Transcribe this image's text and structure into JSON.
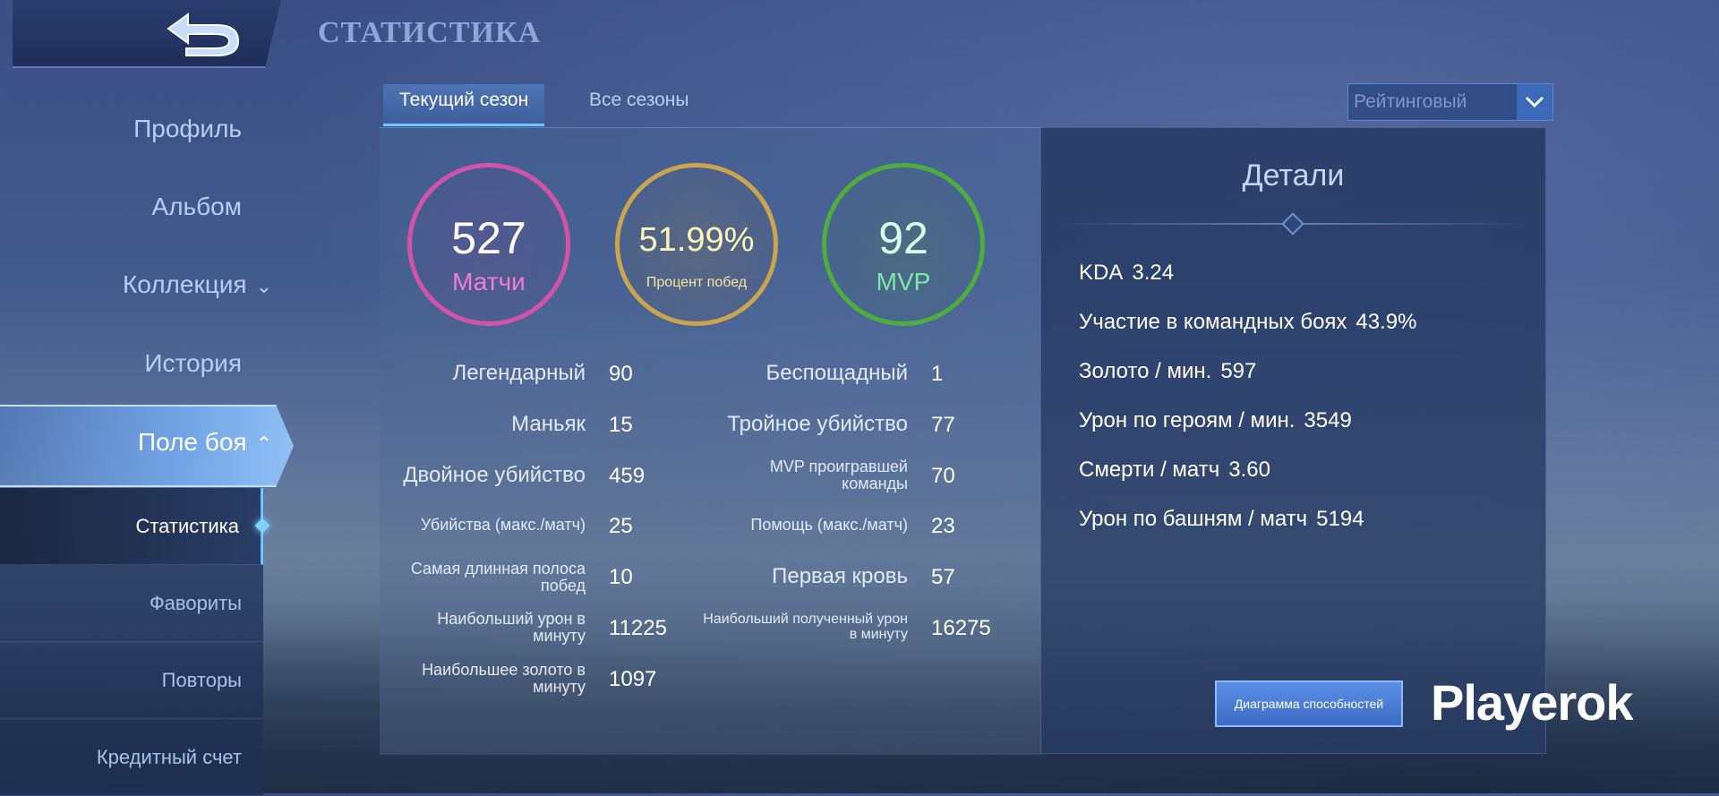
{
  "header": {
    "title": "СТАТИСТИКА",
    "back_icon": "back-arrow-icon"
  },
  "sidebar": {
    "items": [
      {
        "label": "Профиль"
      },
      {
        "label": "Альбом"
      },
      {
        "label": "Коллекция",
        "chevron": "⌄"
      },
      {
        "label": "История"
      },
      {
        "label": "Поле боя",
        "chevron": "⌃"
      }
    ],
    "subitems": [
      {
        "label": "Статистика"
      },
      {
        "label": "Фавориты"
      },
      {
        "label": "Повторы"
      },
      {
        "label": "Кредитный счет"
      }
    ]
  },
  "tabs": [
    {
      "label": "Текущий сезон"
    },
    {
      "label": "Все сезоны"
    }
  ],
  "mode_select": {
    "value": "Рейтинговый"
  },
  "summary": {
    "matches": {
      "value": "527",
      "label": "Матчи"
    },
    "winrate": {
      "value": "51.99%",
      "label": "Процент побед"
    },
    "mvp": {
      "value": "92",
      "label": "MVP"
    }
  },
  "stats_left": [
    {
      "label": "Легендарный",
      "value": "90"
    },
    {
      "label": "Маньяк",
      "value": "15"
    },
    {
      "label": "Двойное убийство",
      "value": "459"
    },
    {
      "label": "Убийства (макс./матч)",
      "value": "25"
    },
    {
      "label": "Самая длинная полоса побед",
      "value": "10"
    },
    {
      "label": "Наибольший урон в минуту",
      "value": "11225"
    },
    {
      "label": "Наибольшее золото в минуту",
      "value": "1097"
    }
  ],
  "stats_right": [
    {
      "label": "Беспощадный",
      "value": "1"
    },
    {
      "label": "Тройное убийство",
      "value": "77"
    },
    {
      "label": "MVP проигравшей команды",
      "value": "70"
    },
    {
      "label": "Помощь (макс./матч)",
      "value": "23"
    },
    {
      "label": "Первая кровь",
      "value": "57"
    },
    {
      "label": "Наибольший полученный урон в минуту",
      "value": "16275"
    }
  ],
  "details": {
    "title": "Детали",
    "rows": [
      {
        "label": "KDA",
        "value": "3.24"
      },
      {
        "label": "Участие в командных боях",
        "value": "43.9%"
      },
      {
        "label": "Золото / мин.",
        "value": "597"
      },
      {
        "label": "Урон по героям / мин.",
        "value": "3549"
      },
      {
        "label": "Смерти / матч",
        "value": "3.60"
      },
      {
        "label": "Урон по башням / матч",
        "value": "5194"
      }
    ],
    "button_label": "Диаграмма способностей"
  },
  "watermark": "Playerok",
  "colors": {
    "matches": "#d353a9",
    "winrate": "#c9a64e",
    "mvp": "#4fad3e",
    "accent": "#6fc6ff"
  }
}
